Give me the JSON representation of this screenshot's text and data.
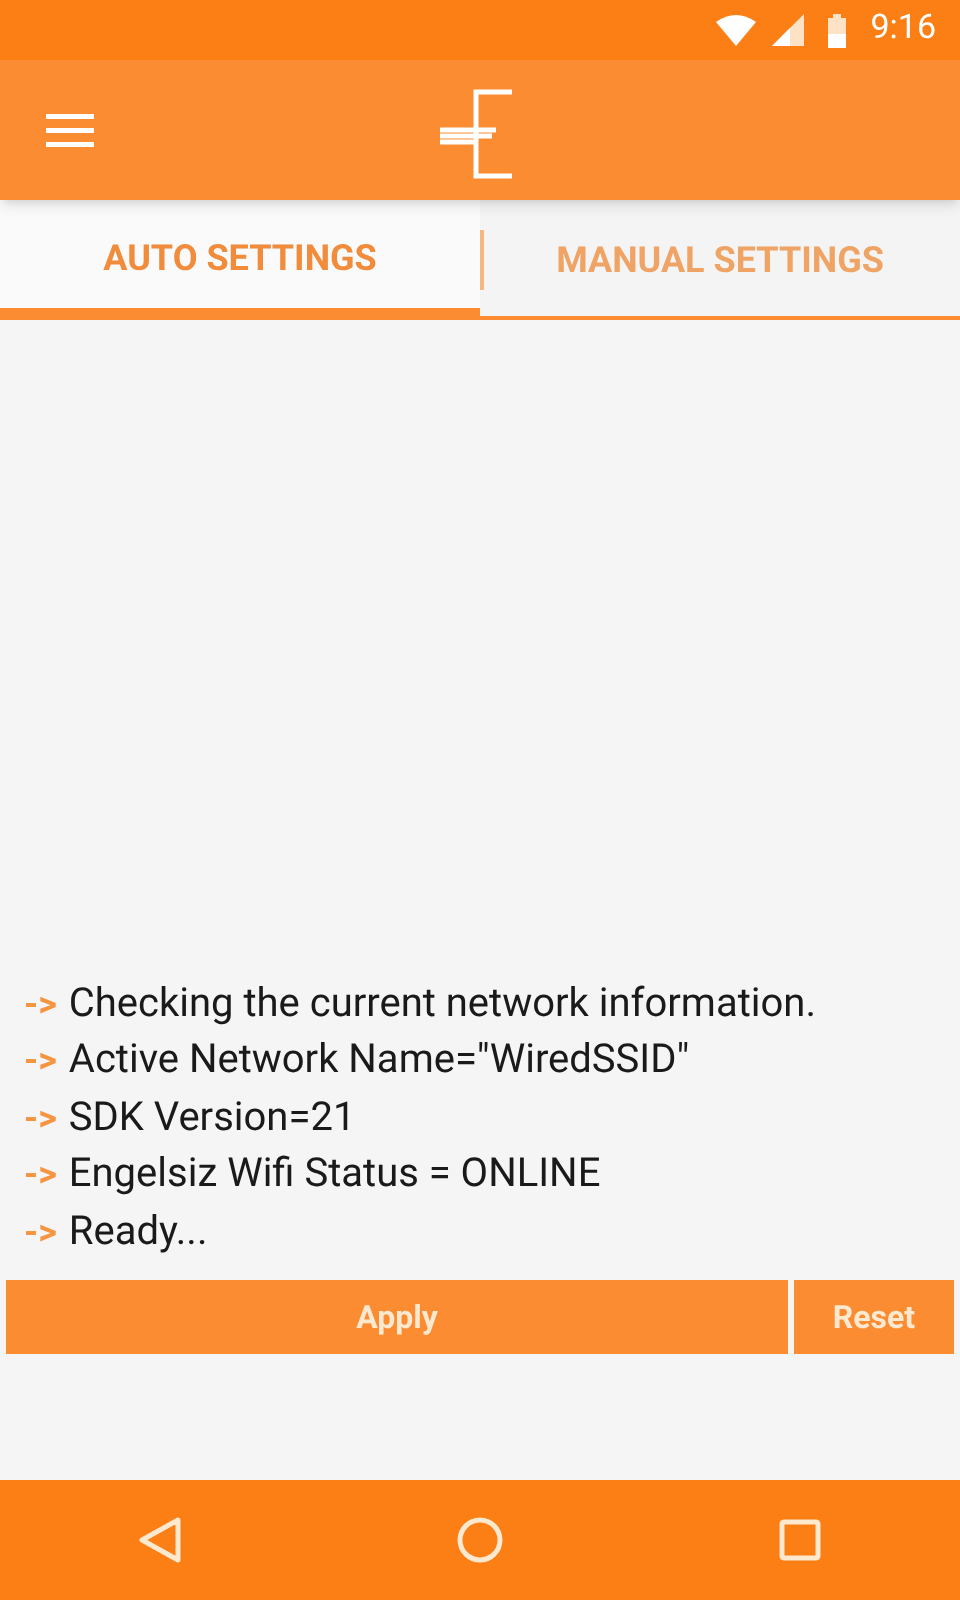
{
  "status_bar": {
    "time": "9:16"
  },
  "tabs": [
    {
      "label": "AUTO SETTINGS",
      "selected": true
    },
    {
      "label": "MANUAL SETTINGS",
      "selected": false
    }
  ],
  "log": [
    {
      "prefix": "->",
      "text": "Checking the current network information."
    },
    {
      "prefix": "->",
      "text": "Active Network Name=\"WiredSSID\""
    },
    {
      "prefix": "->",
      "text": "SDK Version=21"
    },
    {
      "prefix": "->",
      "text": "Engelsiz Wifi Status = ONLINE"
    },
    {
      "prefix": "->",
      "text": "Ready..."
    }
  ],
  "buttons": [
    {
      "label": "Apply",
      "kind": "wide"
    },
    {
      "label": "Reset",
      "kind": "narrow"
    }
  ]
}
